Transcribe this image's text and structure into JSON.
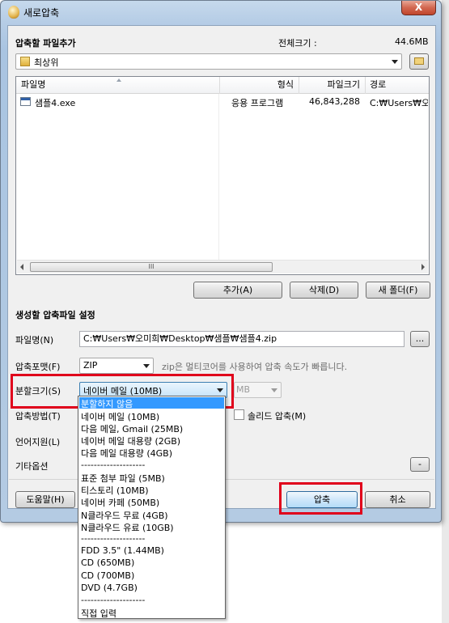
{
  "window": {
    "title": "새로압축",
    "close_label": "X"
  },
  "files_section": {
    "heading": "압축할 파일추가",
    "total_size_label": "전체크기 :",
    "total_size_value": "44.6MB"
  },
  "folder_combo": {
    "value": "최상위"
  },
  "file_list": {
    "columns": [
      "파일명",
      "형식",
      "파일크기",
      "경로"
    ],
    "rows": [
      {
        "name": "샘플4.exe",
        "type": "응용 프로그램",
        "size": "46,843,288",
        "path": "C:₩Users₩오미"
      }
    ],
    "scroll_center": "III"
  },
  "list_buttons": {
    "add": "추가(A)",
    "delete": "삭제(D)",
    "new_folder": "새 폴더(F)"
  },
  "settings": {
    "heading": "생성할 압축파일 설정",
    "filename_label": "파일명(N)",
    "filename_value": "C:₩Users₩오미희₩Desktop₩샘플₩샘플4.zip",
    "browse_label": "...",
    "format_label": "압축포맷(F)",
    "format_value": "ZIP",
    "format_hint": "zip은 멀티코어를 사용하여 압축 속도가 빠릅니다.",
    "split_label": "분할크기(S)",
    "split_value": "네이버 메일 (10MB)",
    "split_unit": "MB",
    "method_label": "압축방법(T)",
    "solid_label": "솔리드 압축(M)",
    "lang_label": "언어지원(L)",
    "etc_label": "기타옵션",
    "etc_button": "-"
  },
  "bottom_buttons": {
    "help": "도움말(H)",
    "compress": "압축",
    "cancel": "취소"
  },
  "split_dropdown": [
    "분할하지 않음",
    "네이버 메일 (10MB)",
    "다음 메일, Gmail (25MB)",
    "네이버 메일 대용량 (2GB)",
    "다음 메일 대용량 (4GB)",
    "--------------------",
    "표준 첨부 파일 (5MB)",
    "티스토리 (10MB)",
    "네이버 카페 (50MB)",
    "N클라우드 무료 (4GB)",
    "N클라우드 유료 (10GB)",
    "--------------------",
    "FDD 3.5\" (1.44MB)",
    "CD (650MB)",
    "CD (700MB)",
    "DVD (4.7GB)",
    "--------------------",
    "직접 입력"
  ],
  "colors": {
    "highlight": "#3399ff",
    "annotation_red": "#e0001b"
  }
}
